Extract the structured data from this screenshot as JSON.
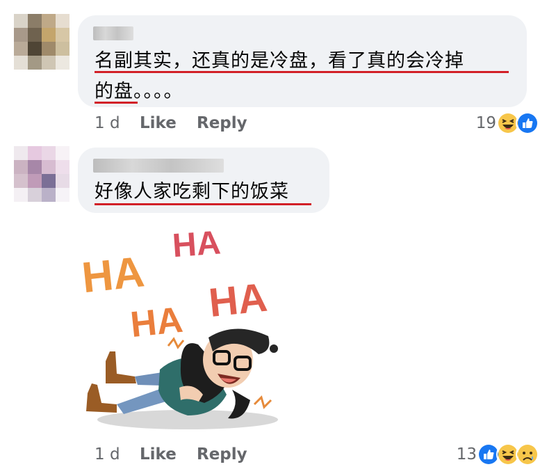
{
  "comments": [
    {
      "text_lines": [
        "名副其实，还真的是冷盘，看了真的会冷掉",
        "的盘。。。。"
      ],
      "time": "1 d",
      "like_label": "Like",
      "reply_label": "Reply",
      "reaction_count": "19",
      "reactions": [
        "haha-icon",
        "like-icon"
      ]
    },
    {
      "text_lines": [
        "好像人家吃剩下的饭菜"
      ],
      "time": "1 d",
      "like_label": "Like",
      "reply_label": "Reply",
      "reaction_count": "13",
      "reactions": [
        "like-icon",
        "haha-icon",
        "sad-icon"
      ],
      "sticker": {
        "words": [
          "HA",
          "HA",
          "HA",
          "HA"
        ]
      }
    }
  ],
  "colors": {
    "bubble": "#f0f2f5",
    "meta_text": "#65676b",
    "underline": "#d22027",
    "like_blue": "#1877f2",
    "haha_yellow": "#f7c64a"
  }
}
